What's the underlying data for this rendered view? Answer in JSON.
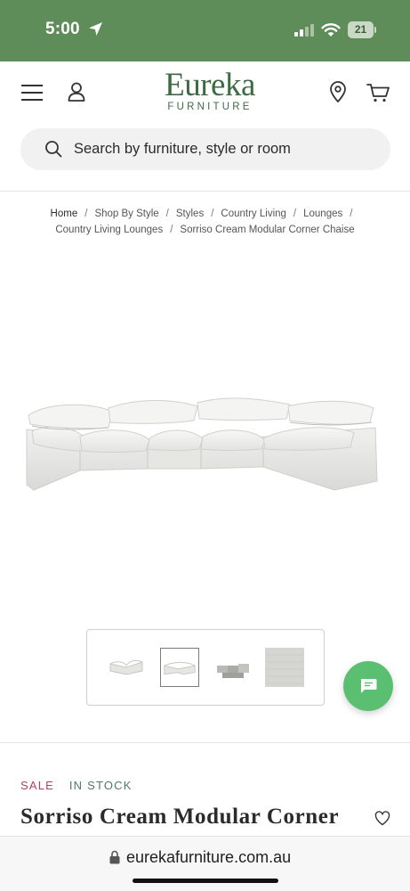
{
  "status_bar": {
    "time": "5:00",
    "battery": "21",
    "background_color": "#5f8d5a"
  },
  "header": {
    "logo_main": "Eureka",
    "logo_sub": "FURNITURE",
    "brand_color": "#3f6a44",
    "icons": [
      "menu-icon",
      "account-icon",
      "location-icon",
      "cart-icon"
    ]
  },
  "search": {
    "placeholder": "Search by furniture, style or room"
  },
  "breadcrumb": {
    "row1": [
      "Home",
      "Shop By Style",
      "Styles",
      "Country Living",
      "Lounges"
    ],
    "row2": [
      "Country Living Lounges",
      "Sorriso Cream Modular Corner Chaise"
    ],
    "separator": "/"
  },
  "gallery": {
    "thumbnails": [
      "thumb-sofa-angle",
      "thumb-sofa-front",
      "thumb-sofa-modules",
      "thumb-fabric-swatch"
    ],
    "selected_index": 1
  },
  "product": {
    "sale_label": "SALE",
    "stock_label": "IN STOCK",
    "title": "Sorriso Cream Modular Corner",
    "sale_color": "#b2416a",
    "stock_color": "#4f7b66"
  },
  "chat": {
    "color": "#5bbf72"
  },
  "browser": {
    "url": "eurekafurniture.com.au"
  }
}
